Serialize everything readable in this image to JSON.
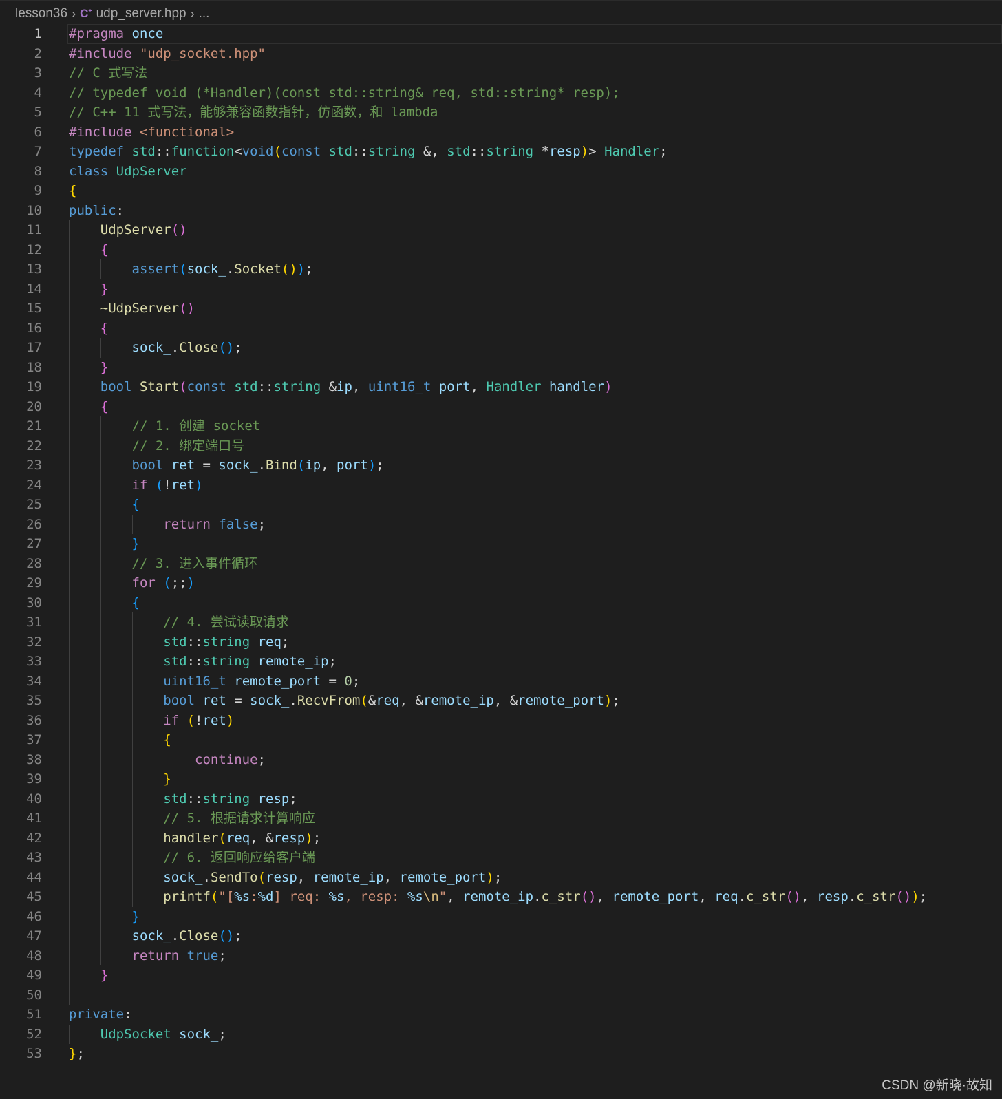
{
  "breadcrumb": {
    "folder": "lesson36",
    "file": "udp_server.hpp",
    "more": "...",
    "file_icon": "C++"
  },
  "watermark": "CSDN @新晓·故知",
  "active_line": 1,
  "colors": {
    "background": "#1e1e1e",
    "keyword": "#c586c0",
    "storage": "#569cd6",
    "type": "#4ec9b0",
    "function": "#dcdcaa",
    "variable": "#9cdcfe",
    "string": "#ce9178",
    "comment": "#6a9955"
  },
  "lines": [
    [
      [
        "k",
        "#pragma"
      ],
      [
        "p",
        " "
      ],
      [
        "v",
        "once"
      ]
    ],
    [
      [
        "k",
        "#include"
      ],
      [
        "p",
        " "
      ],
      [
        "s",
        "\"udp_socket.hpp\""
      ]
    ],
    [
      [
        "c",
        "// C 式写法"
      ]
    ],
    [
      [
        "c",
        "// typedef void (*Handler)(const std::string& req, std::string* resp);"
      ]
    ],
    [
      [
        "c",
        "// C++ 11 式写法，能够兼容函数指针，仿函数，和 lambda"
      ]
    ],
    [
      [
        "k",
        "#include"
      ],
      [
        "p",
        " "
      ],
      [
        "s",
        "<functional>"
      ]
    ],
    [
      [
        "b",
        "typedef"
      ],
      [
        "p",
        " "
      ],
      [
        "t",
        "std"
      ],
      [
        "p",
        "::"
      ],
      [
        "t",
        "function"
      ],
      [
        "p",
        "<"
      ],
      [
        "b",
        "void"
      ],
      [
        "g",
        "("
      ],
      [
        "b",
        "const"
      ],
      [
        "p",
        " "
      ],
      [
        "t",
        "std"
      ],
      [
        "p",
        "::"
      ],
      [
        "t",
        "string"
      ],
      [
        "p",
        " &, "
      ],
      [
        "t",
        "std"
      ],
      [
        "p",
        "::"
      ],
      [
        "t",
        "string"
      ],
      [
        "p",
        " *"
      ],
      [
        "v",
        "resp"
      ],
      [
        "g",
        ")"
      ],
      [
        "p",
        "> "
      ],
      [
        "t",
        "Handler"
      ],
      [
        "p",
        ";"
      ]
    ],
    [
      [
        "b",
        "class"
      ],
      [
        "p",
        " "
      ],
      [
        "t",
        "UdpServer"
      ]
    ],
    [
      [
        "g",
        "{"
      ]
    ],
    [
      [
        "b",
        "public"
      ],
      [
        "p",
        ":"
      ]
    ],
    [
      [
        "p",
        "    "
      ],
      [
        "f",
        "UdpServer"
      ],
      [
        "m",
        "()"
      ]
    ],
    [
      [
        "p",
        "    "
      ],
      [
        "m",
        "{"
      ]
    ],
    [
      [
        "p",
        "        "
      ],
      [
        "b",
        "assert"
      ],
      [
        "l",
        "("
      ],
      [
        "v",
        "sock_"
      ],
      [
        "p",
        "."
      ],
      [
        "f",
        "Socket"
      ],
      [
        "g",
        "()"
      ],
      [
        "l",
        ")"
      ],
      [
        "p",
        ";"
      ]
    ],
    [
      [
        "p",
        "    "
      ],
      [
        "m",
        "}"
      ]
    ],
    [
      [
        "p",
        "    "
      ],
      [
        "f",
        "~UdpServer"
      ],
      [
        "m",
        "()"
      ]
    ],
    [
      [
        "p",
        "    "
      ],
      [
        "m",
        "{"
      ]
    ],
    [
      [
        "p",
        "        "
      ],
      [
        "v",
        "sock_"
      ],
      [
        "p",
        "."
      ],
      [
        "f",
        "Close"
      ],
      [
        "l",
        "()"
      ],
      [
        "p",
        ";"
      ]
    ],
    [
      [
        "p",
        "    "
      ],
      [
        "m",
        "}"
      ]
    ],
    [
      [
        "p",
        "    "
      ],
      [
        "b",
        "bool"
      ],
      [
        "p",
        " "
      ],
      [
        "f",
        "Start"
      ],
      [
        "m",
        "("
      ],
      [
        "b",
        "const"
      ],
      [
        "p",
        " "
      ],
      [
        "t",
        "std"
      ],
      [
        "p",
        "::"
      ],
      [
        "t",
        "string"
      ],
      [
        "p",
        " &"
      ],
      [
        "v",
        "ip"
      ],
      [
        "p",
        ", "
      ],
      [
        "b",
        "uint16_t"
      ],
      [
        "p",
        " "
      ],
      [
        "v",
        "port"
      ],
      [
        "p",
        ", "
      ],
      [
        "t",
        "Handler"
      ],
      [
        "p",
        " "
      ],
      [
        "v",
        "handler"
      ],
      [
        "m",
        ")"
      ]
    ],
    [
      [
        "p",
        "    "
      ],
      [
        "m",
        "{"
      ]
    ],
    [
      [
        "p",
        "        "
      ],
      [
        "c",
        "// 1. 创建 socket"
      ]
    ],
    [
      [
        "p",
        "        "
      ],
      [
        "c",
        "// 2. 绑定端口号"
      ]
    ],
    [
      [
        "p",
        "        "
      ],
      [
        "b",
        "bool"
      ],
      [
        "p",
        " "
      ],
      [
        "v",
        "ret"
      ],
      [
        "p",
        " = "
      ],
      [
        "v",
        "sock_"
      ],
      [
        "p",
        "."
      ],
      [
        "f",
        "Bind"
      ],
      [
        "l",
        "("
      ],
      [
        "v",
        "ip"
      ],
      [
        "p",
        ", "
      ],
      [
        "v",
        "port"
      ],
      [
        "l",
        ")"
      ],
      [
        "p",
        ";"
      ]
    ],
    [
      [
        "p",
        "        "
      ],
      [
        "k",
        "if"
      ],
      [
        "p",
        " "
      ],
      [
        "l",
        "("
      ],
      [
        "p",
        "!"
      ],
      [
        "v",
        "ret"
      ],
      [
        "l",
        ")"
      ]
    ],
    [
      [
        "p",
        "        "
      ],
      [
        "l",
        "{"
      ]
    ],
    [
      [
        "p",
        "            "
      ],
      [
        "k",
        "return"
      ],
      [
        "p",
        " "
      ],
      [
        "b",
        "false"
      ],
      [
        "p",
        ";"
      ]
    ],
    [
      [
        "p",
        "        "
      ],
      [
        "l",
        "}"
      ]
    ],
    [
      [
        "p",
        "        "
      ],
      [
        "c",
        "// 3. 进入事件循环"
      ]
    ],
    [
      [
        "p",
        "        "
      ],
      [
        "k",
        "for"
      ],
      [
        "p",
        " "
      ],
      [
        "l",
        "("
      ],
      [
        "p",
        ";;"
      ],
      [
        "l",
        ")"
      ]
    ],
    [
      [
        "p",
        "        "
      ],
      [
        "l",
        "{"
      ]
    ],
    [
      [
        "p",
        "            "
      ],
      [
        "c",
        "// 4. 尝试读取请求"
      ]
    ],
    [
      [
        "p",
        "            "
      ],
      [
        "t",
        "std"
      ],
      [
        "p",
        "::"
      ],
      [
        "t",
        "string"
      ],
      [
        "p",
        " "
      ],
      [
        "v",
        "req"
      ],
      [
        "p",
        ";"
      ]
    ],
    [
      [
        "p",
        "            "
      ],
      [
        "t",
        "std"
      ],
      [
        "p",
        "::"
      ],
      [
        "t",
        "string"
      ],
      [
        "p",
        " "
      ],
      [
        "v",
        "remote_ip"
      ],
      [
        "p",
        ";"
      ]
    ],
    [
      [
        "p",
        "            "
      ],
      [
        "b",
        "uint16_t"
      ],
      [
        "p",
        " "
      ],
      [
        "v",
        "remote_port"
      ],
      [
        "p",
        " = "
      ],
      [
        "n",
        "0"
      ],
      [
        "p",
        ";"
      ]
    ],
    [
      [
        "p",
        "            "
      ],
      [
        "b",
        "bool"
      ],
      [
        "p",
        " "
      ],
      [
        "v",
        "ret"
      ],
      [
        "p",
        " = "
      ],
      [
        "v",
        "sock_"
      ],
      [
        "p",
        "."
      ],
      [
        "f",
        "RecvFrom"
      ],
      [
        "g",
        "("
      ],
      [
        "p",
        "&"
      ],
      [
        "v",
        "req"
      ],
      [
        "p",
        ", &"
      ],
      [
        "v",
        "remote_ip"
      ],
      [
        "p",
        ", &"
      ],
      [
        "v",
        "remote_port"
      ],
      [
        "g",
        ")"
      ],
      [
        "p",
        ";"
      ]
    ],
    [
      [
        "p",
        "            "
      ],
      [
        "k",
        "if"
      ],
      [
        "p",
        " "
      ],
      [
        "g",
        "("
      ],
      [
        "p",
        "!"
      ],
      [
        "v",
        "ret"
      ],
      [
        "g",
        ")"
      ]
    ],
    [
      [
        "p",
        "            "
      ],
      [
        "g",
        "{"
      ]
    ],
    [
      [
        "p",
        "                "
      ],
      [
        "k",
        "continue"
      ],
      [
        "p",
        ";"
      ]
    ],
    [
      [
        "p",
        "            "
      ],
      [
        "g",
        "}"
      ]
    ],
    [
      [
        "p",
        "            "
      ],
      [
        "t",
        "std"
      ],
      [
        "p",
        "::"
      ],
      [
        "t",
        "string"
      ],
      [
        "p",
        " "
      ],
      [
        "v",
        "resp"
      ],
      [
        "p",
        ";"
      ]
    ],
    [
      [
        "p",
        "            "
      ],
      [
        "c",
        "// 5. 根据请求计算响应"
      ]
    ],
    [
      [
        "p",
        "            "
      ],
      [
        "f",
        "handler"
      ],
      [
        "g",
        "("
      ],
      [
        "v",
        "req"
      ],
      [
        "p",
        ", &"
      ],
      [
        "v",
        "resp"
      ],
      [
        "g",
        ")"
      ],
      [
        "p",
        ";"
      ]
    ],
    [
      [
        "p",
        "            "
      ],
      [
        "c",
        "// 6. 返回响应给客户端"
      ]
    ],
    [
      [
        "p",
        "            "
      ],
      [
        "v",
        "sock_"
      ],
      [
        "p",
        "."
      ],
      [
        "f",
        "SendTo"
      ],
      [
        "g",
        "("
      ],
      [
        "v",
        "resp"
      ],
      [
        "p",
        ", "
      ],
      [
        "v",
        "remote_ip"
      ],
      [
        "p",
        ", "
      ],
      [
        "v",
        "remote_port"
      ],
      [
        "g",
        ")"
      ],
      [
        "p",
        ";"
      ]
    ],
    [
      [
        "p",
        "            "
      ],
      [
        "f",
        "printf"
      ],
      [
        "g",
        "("
      ],
      [
        "s",
        "\"["
      ],
      [
        "e",
        "%s"
      ],
      [
        "s",
        ":"
      ],
      [
        "e",
        "%d"
      ],
      [
        "s",
        "] req: "
      ],
      [
        "e",
        "%s"
      ],
      [
        "s",
        ", resp: "
      ],
      [
        "e",
        "%s"
      ],
      [
        "x",
        "\\n"
      ],
      [
        "s",
        "\""
      ],
      [
        "p",
        ", "
      ],
      [
        "v",
        "remote_ip"
      ],
      [
        "p",
        "."
      ],
      [
        "f",
        "c_str"
      ],
      [
        "m",
        "()"
      ],
      [
        "p",
        ", "
      ],
      [
        "v",
        "remote_port"
      ],
      [
        "p",
        ", "
      ],
      [
        "v",
        "req"
      ],
      [
        "p",
        "."
      ],
      [
        "f",
        "c_str"
      ],
      [
        "m",
        "()"
      ],
      [
        "p",
        ", "
      ],
      [
        "v",
        "resp"
      ],
      [
        "p",
        "."
      ],
      [
        "f",
        "c_str"
      ],
      [
        "m",
        "()"
      ],
      [
        "g",
        ")"
      ],
      [
        "p",
        ";"
      ]
    ],
    [
      [
        "p",
        "        "
      ],
      [
        "l",
        "}"
      ]
    ],
    [
      [
        "p",
        "        "
      ],
      [
        "v",
        "sock_"
      ],
      [
        "p",
        "."
      ],
      [
        "f",
        "Close"
      ],
      [
        "l",
        "()"
      ],
      [
        "p",
        ";"
      ]
    ],
    [
      [
        "p",
        "        "
      ],
      [
        "k",
        "return"
      ],
      [
        "p",
        " "
      ],
      [
        "b",
        "true"
      ],
      [
        "p",
        ";"
      ]
    ],
    [
      [
        "p",
        "    "
      ],
      [
        "m",
        "}"
      ]
    ],
    [],
    [
      [
        "b",
        "private"
      ],
      [
        "p",
        ":"
      ]
    ],
    [
      [
        "p",
        "    "
      ],
      [
        "t",
        "UdpSocket"
      ],
      [
        "p",
        " "
      ],
      [
        "v",
        "sock_"
      ],
      [
        "p",
        ";"
      ]
    ],
    [
      [
        "g",
        "}"
      ],
      [
        "p",
        ";"
      ]
    ]
  ]
}
